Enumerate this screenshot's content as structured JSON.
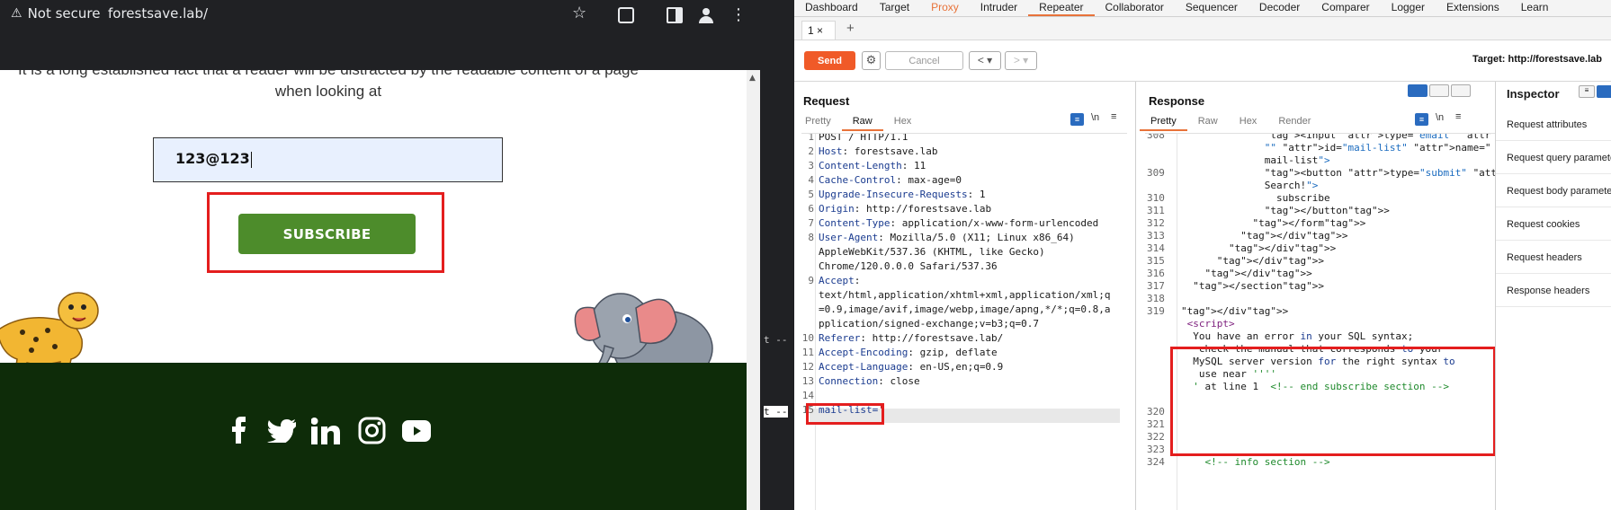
{
  "browser": {
    "security_label": "Not secure",
    "url": "forestsave.lab/",
    "lead_text_line1": "It is a long established fact that a reader will be distracted by the readable content of a page",
    "lead_text_line2": "when looking at",
    "email_value": "123@123",
    "subscribe_label": "SUBSCRIBE"
  },
  "terminal_fragments": [
    "t --",
    "t --"
  ],
  "burp": {
    "menu": [
      "Dashboard",
      "Target",
      "Proxy",
      "Intruder",
      "Repeater",
      "Collaborator",
      "Sequencer",
      "Decoder",
      "Comparer",
      "Logger",
      "Extensions",
      "Learn"
    ],
    "tab_label": "1 ×",
    "send_label": "Send",
    "cancel_label": "Cancel",
    "target_label": "Target: http://forestsave.lab",
    "request": {
      "title": "Request",
      "subtabs": [
        "Pretty",
        "Raw",
        "Hex"
      ],
      "lines": [
        {
          "n": "1",
          "name": "",
          "value": "POST / HTTP/1.1"
        },
        {
          "n": "2",
          "name": "Host",
          "value": ": forestsave.lab"
        },
        {
          "n": "3",
          "name": "Content-Length",
          "value": ": 11"
        },
        {
          "n": "4",
          "name": "Cache-Control",
          "value": ": max-age=0"
        },
        {
          "n": "5",
          "name": "Upgrade-Insecure-Requests",
          "value": ": 1"
        },
        {
          "n": "6",
          "name": "Origin",
          "value": ": http://forestsave.lab"
        },
        {
          "n": "7",
          "name": "Content-Type",
          "value": ": application/x-www-form-urlencoded"
        },
        {
          "n": "8",
          "name": "User-Agent",
          "value": ": Mozilla/5.0 (X11; Linux x86_64)"
        },
        {
          "n": "",
          "name": "",
          "value": "AppleWebKit/537.36 (KHTML, like Gecko)"
        },
        {
          "n": "",
          "name": "",
          "value": "Chrome/120.0.0.0 Safari/537.36"
        },
        {
          "n": "9",
          "name": "Accept",
          "value": ":"
        },
        {
          "n": "",
          "name": "",
          "value": "text/html,application/xhtml+xml,application/xml;q"
        },
        {
          "n": "",
          "name": "",
          "value": "=0.9,image/avif,image/webp,image/apng,*/*;q=0.8,a"
        },
        {
          "n": "",
          "name": "",
          "value": "pplication/signed-exchange;v=b3;q=0.7"
        },
        {
          "n": "10",
          "name": "Referer",
          "value": ": http://forestsave.lab/"
        },
        {
          "n": "11",
          "name": "Accept-Encoding",
          "value": ": gzip, deflate"
        },
        {
          "n": "12",
          "name": "Accept-Language",
          "value": ": en-US,en;q=0.9"
        },
        {
          "n": "13",
          "name": "Connection",
          "value": ": close"
        },
        {
          "n": "14",
          "name": "",
          "value": ""
        },
        {
          "n": "15",
          "name": "mail-list=",
          "value": "'"
        }
      ]
    },
    "response": {
      "title": "Response",
      "subtabs": [
        "Pretty",
        "Raw",
        "Hex",
        "Render"
      ],
      "lines": [
        {
          "n": "308",
          "html": "              <input type=\"email\" placeholder="
        },
        {
          "n": "",
          "html": "              \"\" id=\"mail-list\" name=\""
        },
        {
          "n": "",
          "html": "              mail-list\">"
        },
        {
          "n": "309",
          "html": "              <button type=\"submit\" value=\""
        },
        {
          "n": "",
          "html": "              Search!\">"
        },
        {
          "n": "310",
          "html": "                subscribe"
        },
        {
          "n": "311",
          "html": "              </button>"
        },
        {
          "n": "312",
          "html": "            </form>"
        },
        {
          "n": "313",
          "html": "          </div>"
        },
        {
          "n": "314",
          "html": "        </div>"
        },
        {
          "n": "315",
          "html": "      </div>"
        },
        {
          "n": "316",
          "html": "    </div>"
        },
        {
          "n": "317",
          "html": "  </section>"
        },
        {
          "n": "318",
          "html": ""
        },
        {
          "n": "319",
          "html": "</div>"
        },
        {
          "n": "",
          "html": " <script>"
        },
        {
          "n": "",
          "html": "  You have an error in your SQL syntax;"
        },
        {
          "n": "",
          "html": "   check the manual that corresponds to your"
        },
        {
          "n": "",
          "html": "  MySQL server version for the right syntax to"
        },
        {
          "n": "",
          "html": "   use near ''''"
        },
        {
          "n": "",
          "html": "  ' at line 1  <!-- end subscribe section -->"
        },
        {
          "n": "",
          "html": ""
        },
        {
          "n": "320",
          "html": ""
        },
        {
          "n": "321",
          "html": ""
        },
        {
          "n": "322",
          "html": ""
        },
        {
          "n": "323",
          "html": ""
        },
        {
          "n": "324",
          "html": "    <!-- info section -->"
        }
      ]
    },
    "inspector": {
      "title": "Inspector",
      "items": [
        "Request attributes",
        "Request query parameters",
        "Request body parameters",
        "Request cookies",
        "Request headers",
        "Response headers"
      ]
    }
  }
}
